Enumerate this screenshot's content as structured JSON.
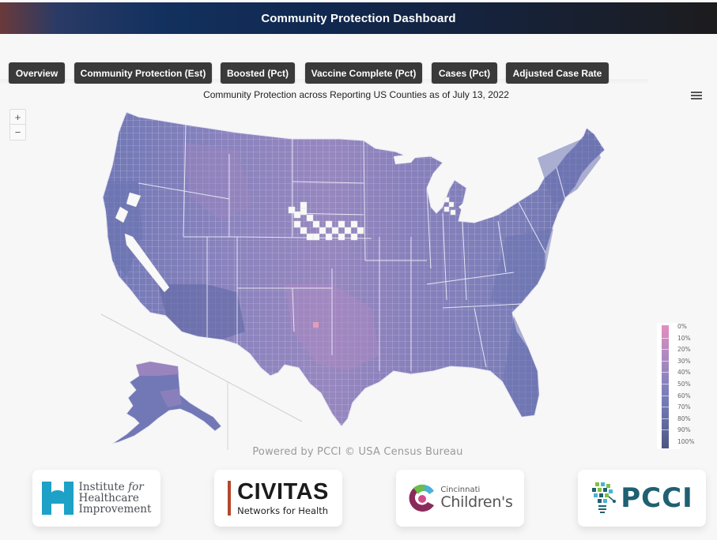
{
  "header": {
    "title": "Community Protection Dashboard"
  },
  "tabs": [
    {
      "label": "Overview",
      "active": false
    },
    {
      "label": "Community Protection (Est)",
      "active": true
    },
    {
      "label": "Boosted (Pct)",
      "active": false
    },
    {
      "label": "Vaccine Complete (Pct)",
      "active": false
    },
    {
      "label": "Cases (Pct)",
      "active": false
    },
    {
      "label": "Adjusted Case Rate",
      "active": false
    }
  ],
  "map": {
    "title": "Community Protection across Reporting US Counties as of July 13, 2022",
    "zoom_in": "+",
    "zoom_out": "−",
    "menu_icon": "hamburger-menu-icon",
    "colors": {
      "low": "#e48ec0",
      "mid": "#8f86bf",
      "high": "#4d5580",
      "no_data": "#f7f7f7",
      "border": "#dcdcf0"
    },
    "legend": {
      "title": "",
      "labels": [
        "0%",
        "10%",
        "20%",
        "30%",
        "40%",
        "50%",
        "60%",
        "70%",
        "80%",
        "90%",
        "100%"
      ]
    },
    "credit": "Powered by PCCI © USA Census Bureau"
  },
  "partners": [
    {
      "name": "Institute for Healthcare Improvement",
      "line1": "Institute ",
      "line1_italic": "for",
      "line2": "Healthcare",
      "line3": "Improvement"
    },
    {
      "name": "CIVITAS Networks for Health",
      "big": "CIVITAS",
      "small": "Networks for Health"
    },
    {
      "name": "Cincinnati Children's",
      "small": "Cincinnati",
      "big": "Children's"
    },
    {
      "name": "PCCI",
      "big": "PCCI"
    }
  ]
}
